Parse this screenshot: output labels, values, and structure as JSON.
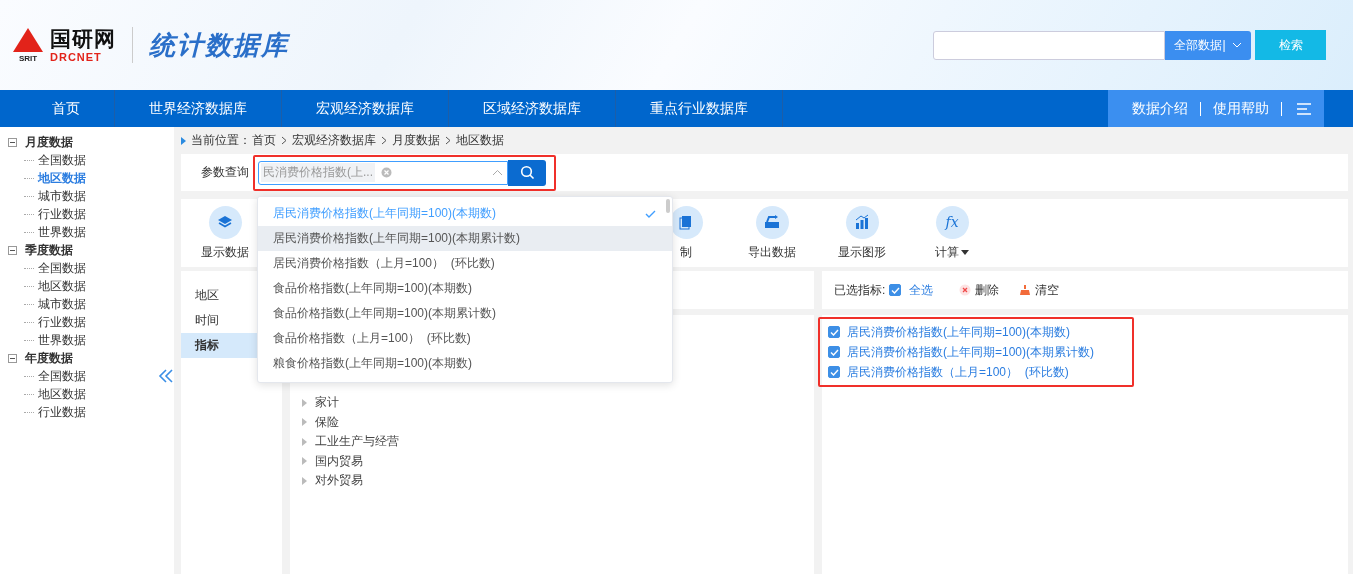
{
  "header": {
    "logo": {
      "cn": "国研网",
      "en_left": "SRIT",
      "en_right": "DRCNET"
    },
    "title": "统计数据库",
    "search": {
      "scope": "全部数据|",
      "button": "检索"
    }
  },
  "nav": {
    "items": [
      "首页",
      "世界经济数据库",
      "宏观经济数据库",
      "区域经济数据库",
      "重点行业数据库"
    ],
    "links": [
      "数据介绍",
      "使用帮助"
    ]
  },
  "sidebar": {
    "groups": [
      {
        "label": "月度数据",
        "expanded": true,
        "children": [
          {
            "label": "全国数据",
            "selected": false
          },
          {
            "label": "地区数据",
            "selected": true
          },
          {
            "label": "城市数据",
            "selected": false
          },
          {
            "label": "行业数据",
            "selected": false
          },
          {
            "label": "世界数据",
            "selected": false
          }
        ]
      },
      {
        "label": "季度数据",
        "expanded": true,
        "children": [
          {
            "label": "全国数据",
            "selected": false
          },
          {
            "label": "地区数据",
            "selected": false
          },
          {
            "label": "城市数据",
            "selected": false
          },
          {
            "label": "行业数据",
            "selected": false
          },
          {
            "label": "世界数据",
            "selected": false
          }
        ]
      },
      {
        "label": "年度数据",
        "expanded": true,
        "children": [
          {
            "label": "全国数据",
            "selected": false
          },
          {
            "label": "地区数据",
            "selected": false
          },
          {
            "label": "行业数据",
            "selected": false
          }
        ]
      }
    ]
  },
  "breadcrumb": {
    "label": "当前位置：",
    "items": [
      "首页",
      "宏观经济数据库",
      "月度数据",
      "地区数据"
    ]
  },
  "query": {
    "label": "参数查询",
    "tag": "民消费价格指数(上...",
    "expanded": true
  },
  "dropdown": [
    {
      "label": "居民消费价格指数(上年同期=100)(本期数)",
      "selected": true,
      "highlighted": false
    },
    {
      "label": "居民消费价格指数(上年同期=100)(本期累计数)",
      "selected": false,
      "highlighted": true
    },
    {
      "label": "居民消费价格指数（上月=100）  (环比数)",
      "selected": false,
      "highlighted": false
    },
    {
      "label": "食品价格指数(上年同期=100)(本期数)",
      "selected": false,
      "highlighted": false
    },
    {
      "label": "食品价格指数(上年同期=100)(本期累计数)",
      "selected": false,
      "highlighted": false
    },
    {
      "label": "食品价格指数（上月=100）  (环比数)",
      "selected": false,
      "highlighted": false
    },
    {
      "label": "粮食价格指数(上年同期=100)(本期数)",
      "selected": false,
      "highlighted": false
    }
  ],
  "toolbar": [
    {
      "kind": "layers",
      "label": "显示数据",
      "dropdown": false
    },
    {
      "kind": "copy",
      "label": "制",
      "dropdown": false
    },
    {
      "kind": "export",
      "label": "导出数据",
      "dropdown": false
    },
    {
      "kind": "chart",
      "label": "显示图形",
      "dropdown": false
    },
    {
      "kind": "fx",
      "label": "计算",
      "dropdown": true
    }
  ],
  "dimension_tabs": [
    {
      "label": "地区",
      "selected": false
    },
    {
      "label": "时间",
      "selected": false
    },
    {
      "label": "指标",
      "selected": true
    }
  ],
  "indicator_tree": [
    "家计",
    "保险",
    "工业生产与经营",
    "国内贸易",
    "对外贸易"
  ],
  "selected_panel": {
    "label": "已选指标:",
    "select_all": {
      "label": "全选",
      "checked": true
    },
    "delete": "删除",
    "clear": "清空",
    "items": [
      {
        "label": "居民消费价格指数(上年同期=100)(本期数)",
        "checked": true
      },
      {
        "label": "居民消费价格指数(上年同期=100)(本期累计数)",
        "checked": true
      },
      {
        "label": "居民消费价格指数（上月=100）  (环比数)",
        "checked": true
      }
    ]
  }
}
